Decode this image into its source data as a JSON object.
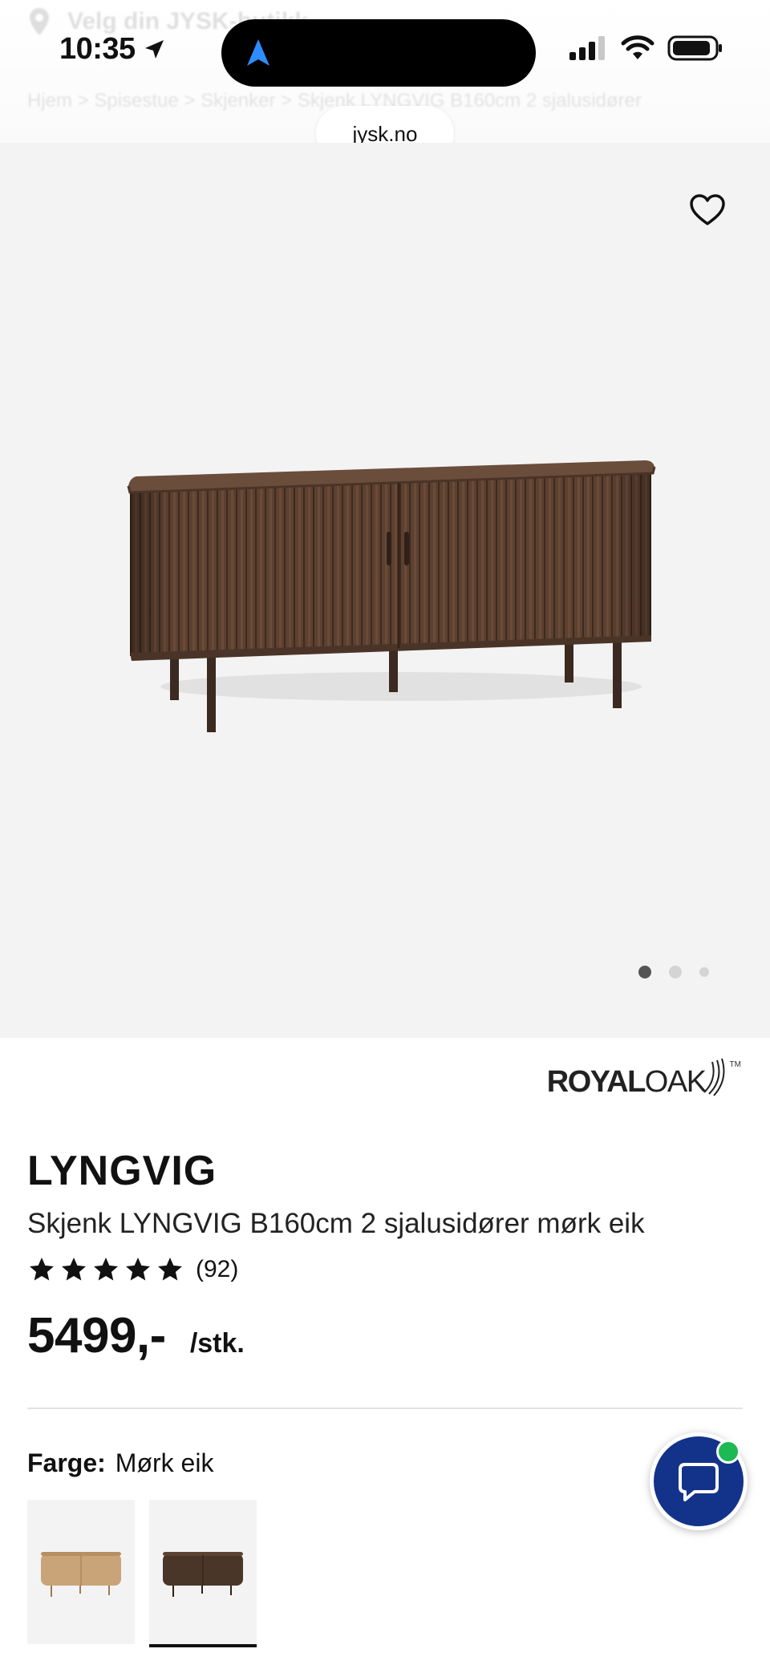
{
  "status": {
    "time": "10:35"
  },
  "browser": {
    "url": "jysk.no"
  },
  "ghost_header": {
    "store_text": "Velg din JYSK-butikk",
    "breadcrumb": "Hjem  >  Spisestue  >  Skjenker  >  Skjenk LYNGVIG B160cm 2 sjalusidører"
  },
  "gallery": {
    "total_images": 3,
    "active_index": 0
  },
  "product": {
    "brand": {
      "royal": "ROYAL",
      "oak": "OAK",
      "tm": "TM"
    },
    "name": "LYNGVIG",
    "description": "Skjenk LYNGVIG B160cm 2 sjalusidører mørk eik",
    "rating": {
      "stars": 5,
      "count_label": "(92)"
    },
    "price": "5499,-",
    "price_unit": "/stk.",
    "color": {
      "label": "Farge:",
      "value": "Mørk eik",
      "options": [
        {
          "name": "Lys eik",
          "tone": "#c9a479",
          "selected": false
        },
        {
          "name": "Mørk eik",
          "tone": "#4a3529",
          "selected": true
        }
      ]
    }
  },
  "colors": {
    "chat_bg": "#13338a",
    "chat_online": "#1db954",
    "wood_dark": "#5a3f2f"
  }
}
